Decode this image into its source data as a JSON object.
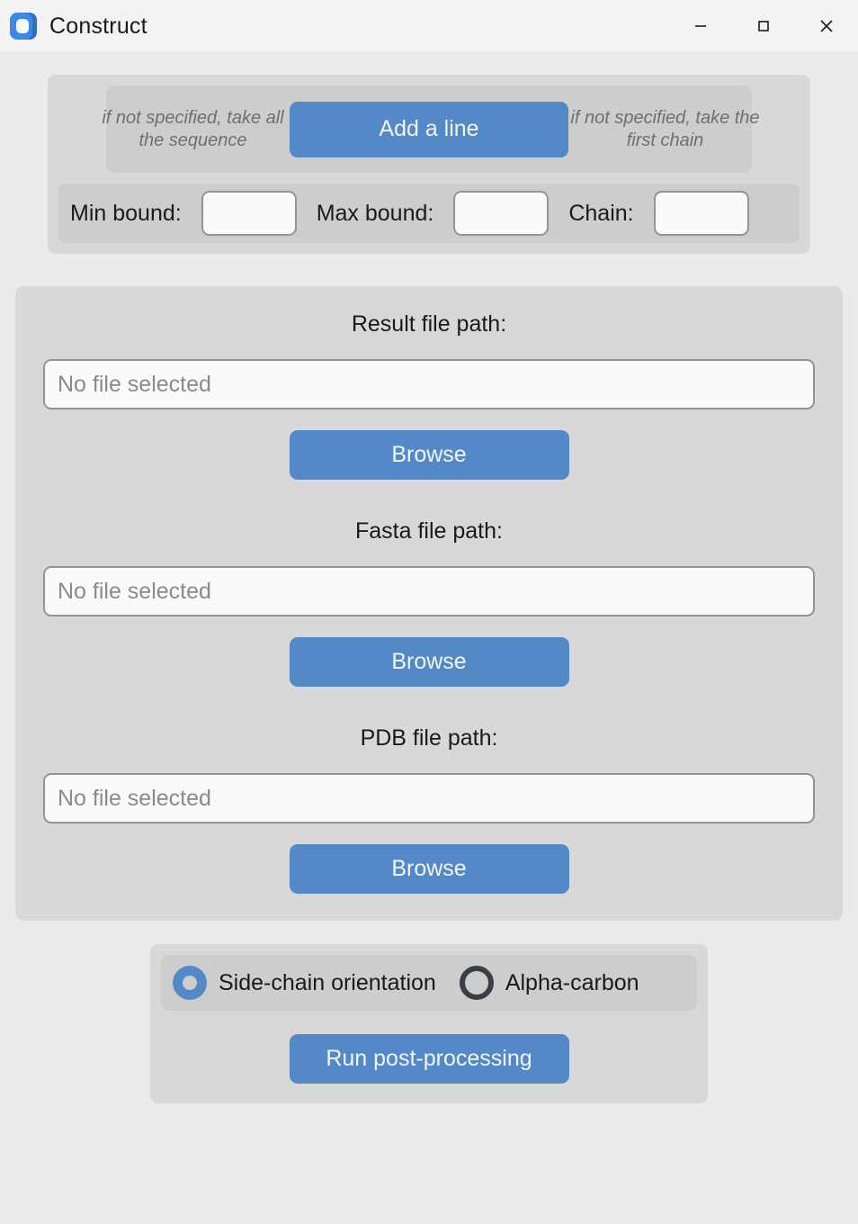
{
  "window": {
    "title": "Construct",
    "icon": "app-logo-icon",
    "controls": {
      "minimize": "minimize-icon",
      "maximize": "maximize-icon",
      "close": "close-icon"
    }
  },
  "colors": {
    "accent": "#5389c7",
    "panel": "#d8d8d8",
    "subpanel": "#cdcdcd",
    "page_background": "#ebebeb",
    "titlebar": "#f3f3f3",
    "input_border": "#949494",
    "hint_text": "#6f6f6f",
    "radio_unselected": "#3a3f45"
  },
  "top_section": {
    "hint_left": "if not specified,\ntake all the sequence",
    "add_line_label": "Add a line",
    "hint_right": "if not specified,\ntake the first chain",
    "bounds": [
      {
        "label": "Min bound:",
        "value": "",
        "placeholder": ""
      },
      {
        "label": "Max bound:",
        "value": "",
        "placeholder": ""
      },
      {
        "label": "Chain:",
        "value": "",
        "placeholder": ""
      }
    ]
  },
  "files_section": {
    "fields": [
      {
        "label": "Result file path:",
        "value": "",
        "placeholder": "No file selected",
        "browse_label": "Browse"
      },
      {
        "label": "Fasta file path:",
        "value": "",
        "placeholder": "No file selected",
        "browse_label": "Browse"
      },
      {
        "label": "PDB file path:",
        "value": "",
        "placeholder": "No file selected",
        "browse_label": "Browse"
      }
    ]
  },
  "bottom_section": {
    "radio_options": [
      {
        "label": "Side-chain orientation",
        "selected": true
      },
      {
        "label": "Alpha-carbon",
        "selected": false
      }
    ],
    "run_label": "Run post-processing"
  }
}
